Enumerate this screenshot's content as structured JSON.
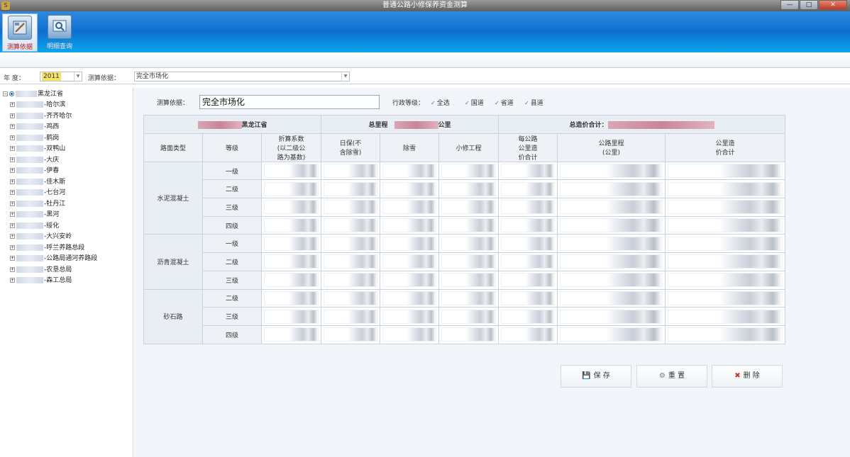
{
  "window": {
    "title": "普通公路小修保养资金测算",
    "min": "—",
    "max": "□",
    "close": "✕"
  },
  "ribbon": {
    "btn1": "测算依据",
    "btn2": "明细查询"
  },
  "filter": {
    "year_label": "年  度：",
    "year_value": "2011",
    "basis_label": "测算依据：",
    "basis_value": "完全市场化"
  },
  "tree": {
    "root": "黑龙江省",
    "children": [
      "哈尔滨",
      "齐齐哈尔",
      "鸡西",
      "鹤岗",
      "双鸭山",
      "大庆",
      "伊春",
      "佳木斯",
      "七台河",
      "牡丹江",
      "黑河",
      "绥化",
      "大兴安岭",
      "呼兰养路总段",
      "公路局通河养路段",
      "农垦总局",
      "森工总局"
    ]
  },
  "form": {
    "basis_label": "测算依据：",
    "basis_value": "完全市场化",
    "level_label": "行政等级：",
    "checks": [
      "全选",
      "国道",
      "省道",
      "县道"
    ]
  },
  "table": {
    "province": "黑龙江省",
    "total_mileage_label": "总里程",
    "mileage_unit": "公里",
    "total_cost_label": "总造价合计：",
    "headers": [
      "路面类型",
      "等级",
      "折算系数\n(以二级公\n路为基数)",
      "日保(不\n含除雪)",
      "除雪",
      "小修工程",
      "每公路\n公里造\n价合计",
      "公路里程\n(公里)",
      "公里造\n价合计"
    ],
    "groups": [
      {
        "type": "水泥混凝土",
        "levels": [
          "一级",
          "二级",
          "三级",
          "四级"
        ]
      },
      {
        "type": "沥青混凝土",
        "levels": [
          "一级",
          "二级",
          "三级"
        ]
      },
      {
        "type": "砂石路",
        "levels": [
          "二级",
          "三级",
          "四级"
        ]
      }
    ]
  },
  "buttons": {
    "save": "保 存",
    "reset": "重 置",
    "delete": "删 除"
  }
}
